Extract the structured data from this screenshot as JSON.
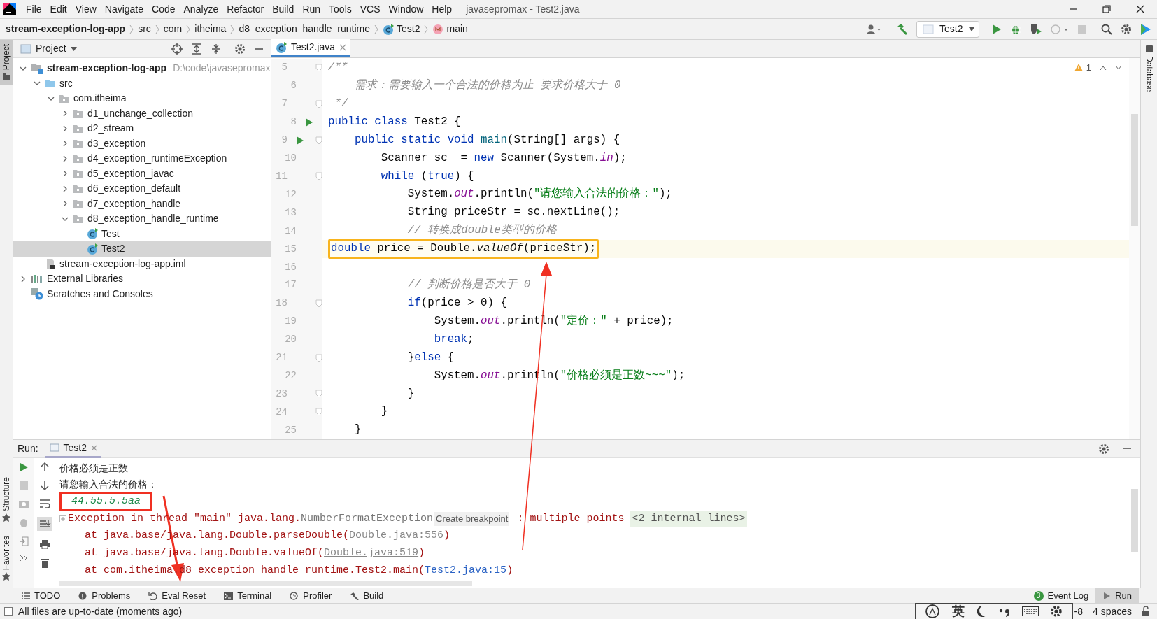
{
  "title_bar": {
    "menus": [
      "File",
      "Edit",
      "View",
      "Navigate",
      "Code",
      "Analyze",
      "Refactor",
      "Build",
      "Run",
      "Tools",
      "VCS",
      "Window",
      "Help"
    ],
    "title": "javasepromax - Test2.java"
  },
  "breadcrumbs": [
    {
      "text": "stream-exception-log-app",
      "kind": "project"
    },
    {
      "text": "src",
      "kind": "folder"
    },
    {
      "text": "com",
      "kind": "folder"
    },
    {
      "text": "itheima",
      "kind": "folder"
    },
    {
      "text": "d8_exception_handle_runtime",
      "kind": "folder"
    },
    {
      "text": "Test2",
      "kind": "class"
    },
    {
      "text": "main",
      "kind": "method"
    }
  ],
  "toolbar": {
    "run_config": "Test2"
  },
  "left_stripe": {
    "top": [
      {
        "label": "Project",
        "selected": true
      }
    ],
    "bottom": [
      {
        "label": "Structure",
        "selected": false
      },
      {
        "label": "Favorites",
        "selected": false
      }
    ]
  },
  "right_stripe": [
    {
      "label": "Database",
      "selected": false
    }
  ],
  "project_panel": {
    "title": "Project",
    "tree": [
      {
        "label": "stream-exception-log-app",
        "path": "D:\\code\\javasepromax",
        "kind": "module",
        "expanded": true,
        "selected": false,
        "children": [
          {
            "label": "src",
            "kind": "source",
            "expanded": true,
            "selected": false,
            "children": [
              {
                "label": "com.itheima",
                "kind": "package",
                "expanded": true,
                "selected": false,
                "children": [
                  {
                    "label": "d1_unchange_collection",
                    "kind": "package",
                    "expanded": false,
                    "selected": false
                  },
                  {
                    "label": "d2_stream",
                    "kind": "package",
                    "expanded": false,
                    "selected": false
                  },
                  {
                    "label": "d3_exception",
                    "kind": "package",
                    "expanded": false,
                    "selected": false
                  },
                  {
                    "label": "d4_exception_runtimeException",
                    "kind": "package",
                    "expanded": false,
                    "selected": false
                  },
                  {
                    "label": "d5_exception_javac",
                    "kind": "package",
                    "expanded": false,
                    "selected": false
                  },
                  {
                    "label": "d6_exception_default",
                    "kind": "package",
                    "expanded": false,
                    "selected": false
                  },
                  {
                    "label": "d7_exception_handle",
                    "kind": "package",
                    "expanded": false,
                    "selected": false
                  },
                  {
                    "label": "d8_exception_handle_runtime",
                    "kind": "package",
                    "expanded": true,
                    "selected": false,
                    "children": [
                      {
                        "label": "Test",
                        "kind": "class",
                        "selected": false
                      },
                      {
                        "label": "Test2",
                        "kind": "class",
                        "selected": true
                      }
                    ]
                  }
                ]
              }
            ]
          },
          {
            "label": "stream-exception-log-app.iml",
            "kind": "file",
            "selected": false
          }
        ]
      },
      {
        "label": "External Libraries",
        "kind": "libraries",
        "expanded": false,
        "selected": false
      },
      {
        "label": "Scratches and Consoles",
        "kind": "scratches",
        "selected": false
      }
    ]
  },
  "editor": {
    "tabs": [
      {
        "label": "Test2.java",
        "selected": true
      }
    ],
    "warnings": "1",
    "lines": [
      {
        "number": "5",
        "fold": true,
        "segments": [
          {
            "kind": "comment",
            "text": "/**"
          }
        ]
      },
      {
        "number": "6",
        "segments": [
          {
            "kind": "comment",
            "text": "    需求：需要输入一个合法的价格为止 要求价格大于 0"
          }
        ]
      },
      {
        "number": "7",
        "fold": true,
        "segments": [
          {
            "kind": "comment",
            "text": " */"
          }
        ]
      },
      {
        "number": "8",
        "run_marker": true,
        "segments": [
          {
            "kind": "keyword",
            "text": "public class"
          },
          {
            "kind": "plain",
            "text": " Test2 {"
          }
        ]
      },
      {
        "number": "9",
        "run_marker": true,
        "fold": true,
        "segments": [
          {
            "kind": "keyword",
            "text": "    public static void "
          },
          {
            "kind": "declaration",
            "text": "main"
          },
          {
            "kind": "plain",
            "text": "(String[] args) {"
          }
        ]
      },
      {
        "number": "10",
        "segments": [
          {
            "kind": "plain",
            "text": "        Scanner sc  = "
          },
          {
            "kind": "keyword",
            "text": "new"
          },
          {
            "kind": "plain",
            "text": " Scanner(System."
          },
          {
            "kind": "static",
            "text": "in"
          },
          {
            "kind": "plain",
            "text": ");"
          }
        ]
      },
      {
        "number": "11",
        "fold": true,
        "segments": [
          {
            "kind": "keyword",
            "text": "        while"
          },
          {
            "kind": "plain",
            "text": " ("
          },
          {
            "kind": "keyword",
            "text": "true"
          },
          {
            "kind": "plain",
            "text": ") {"
          }
        ]
      },
      {
        "number": "12",
        "segments": [
          {
            "kind": "plain",
            "text": "            System."
          },
          {
            "kind": "static",
            "text": "out"
          },
          {
            "kind": "plain",
            "text": ".println("
          },
          {
            "kind": "string",
            "text": "\"请您输入合法的价格：\""
          },
          {
            "kind": "plain",
            "text": ");"
          }
        ]
      },
      {
        "number": "13",
        "segments": [
          {
            "kind": "plain",
            "text": "            String priceStr = sc.nextLine();"
          }
        ]
      },
      {
        "number": "14",
        "segments": [
          {
            "kind": "comment",
            "text": "            // 转换成double类型的价格"
          }
        ]
      },
      {
        "number": "15",
        "highlighted": true,
        "boxed": true,
        "segments": [
          {
            "kind": "keyword",
            "text": "            double"
          },
          {
            "kind": "plain",
            "text": " price = Double."
          },
          {
            "kind": "static_method",
            "text": "valueOf"
          },
          {
            "kind": "plain",
            "text": "(priceStr);"
          }
        ]
      },
      {
        "number": "16"
      },
      {
        "number": "17",
        "segments": [
          {
            "kind": "comment",
            "text": "            // 判断价格是否大于 0"
          }
        ]
      },
      {
        "number": "18",
        "fold": true,
        "segments": [
          {
            "kind": "keyword",
            "text": "            if"
          },
          {
            "kind": "plain",
            "text": "(price > 0) {"
          }
        ]
      },
      {
        "number": "19",
        "segments": [
          {
            "kind": "plain",
            "text": "                System."
          },
          {
            "kind": "static",
            "text": "out"
          },
          {
            "kind": "plain",
            "text": ".println("
          },
          {
            "kind": "string",
            "text": "\"定价：\""
          },
          {
            "kind": "plain",
            "text": " + price);"
          }
        ]
      },
      {
        "number": "20",
        "segments": [
          {
            "kind": "keyword",
            "text": "                break"
          },
          {
            "kind": "plain",
            "text": ";"
          }
        ]
      },
      {
        "number": "21",
        "fold": true,
        "segments": [
          {
            "kind": "plain",
            "text": "            }"
          },
          {
            "kind": "keyword",
            "text": "else"
          },
          {
            "kind": "plain",
            "text": " {"
          }
        ]
      },
      {
        "number": "22",
        "segments": [
          {
            "kind": "plain",
            "text": "                System."
          },
          {
            "kind": "static",
            "text": "out"
          },
          {
            "kind": "plain",
            "text": ".println("
          },
          {
            "kind": "string",
            "text": "\"价格必须是正数~~~\""
          },
          {
            "kind": "plain",
            "text": ");"
          }
        ]
      },
      {
        "number": "23",
        "fold": true,
        "segments": [
          {
            "kind": "plain",
            "text": "            }"
          }
        ]
      },
      {
        "number": "24",
        "fold": true,
        "segments": [
          {
            "kind": "plain",
            "text": "        }"
          }
        ]
      },
      {
        "number": "25",
        "segments": [
          {
            "kind": "plain",
            "text": "    }"
          }
        ]
      }
    ]
  },
  "run_panel": {
    "label": "Run:",
    "tabs": [
      {
        "label": "Test2",
        "selected": true
      }
    ],
    "console": [
      {
        "segments": [
          {
            "kind": "output",
            "text": "价格必须是正数"
          }
        ]
      },
      {
        "segments": [
          {
            "kind": "output",
            "text": "请您输入合法的价格："
          }
        ]
      },
      {
        "boxed": true,
        "segments": [
          {
            "kind": "input",
            "text": "44.55.5.5aa"
          }
        ]
      },
      {
        "collapsible": true,
        "segments": [
          {
            "kind": "error",
            "text": "Exception in thread \"main\" java.lang."
          },
          {
            "kind": "class_link",
            "text": "NumberFormatException"
          },
          {
            "kind": "hint",
            "text": "Create breakpoint"
          },
          {
            "kind": "error",
            "text": " : multiple points "
          },
          {
            "kind": "folded",
            "text": "<2 internal lines>"
          }
        ]
      },
      {
        "segments": [
          {
            "kind": "error",
            "text": "    at java.base/java.lang.Double.parseDouble("
          },
          {
            "kind": "library_link",
            "text": "Double.java:556"
          },
          {
            "kind": "error",
            "text": ")"
          }
        ]
      },
      {
        "segments": [
          {
            "kind": "error",
            "text": "    at java.base/java.lang.Double.valueOf("
          },
          {
            "kind": "library_link",
            "text": "Double.java:519"
          },
          {
            "kind": "error",
            "text": ")"
          }
        ]
      },
      {
        "segments": [
          {
            "kind": "error",
            "text": "    at com.itheima.d8_exception_handle_runtime.Test2.main("
          },
          {
            "kind": "source_link",
            "text": "Test2.java:15"
          },
          {
            "kind": "error",
            "text": ")"
          }
        ]
      }
    ]
  },
  "tool_windows": [
    {
      "label": "TODO",
      "kind": "list",
      "selected": false
    },
    {
      "label": "Problems",
      "kind": "problems",
      "selected": false
    },
    {
      "label": "Eval Reset",
      "kind": "reset",
      "selected": false
    },
    {
      "label": "Terminal",
      "kind": "terminal",
      "selected": false
    },
    {
      "label": "Profiler",
      "kind": "profiler",
      "selected": false
    },
    {
      "label": "Build",
      "kind": "build",
      "selected": false
    }
  ],
  "tool_windows_right": [
    {
      "label": "Event Log",
      "badge": "3",
      "selected": false
    },
    {
      "label": "Run",
      "kind": "run",
      "selected": true
    }
  ],
  "status_bar": {
    "message": "All files are up-to-date (moments ago)",
    "encoding": "-8",
    "indent": "4 spaces"
  },
  "ime_bar": {
    "mode": "英"
  }
}
